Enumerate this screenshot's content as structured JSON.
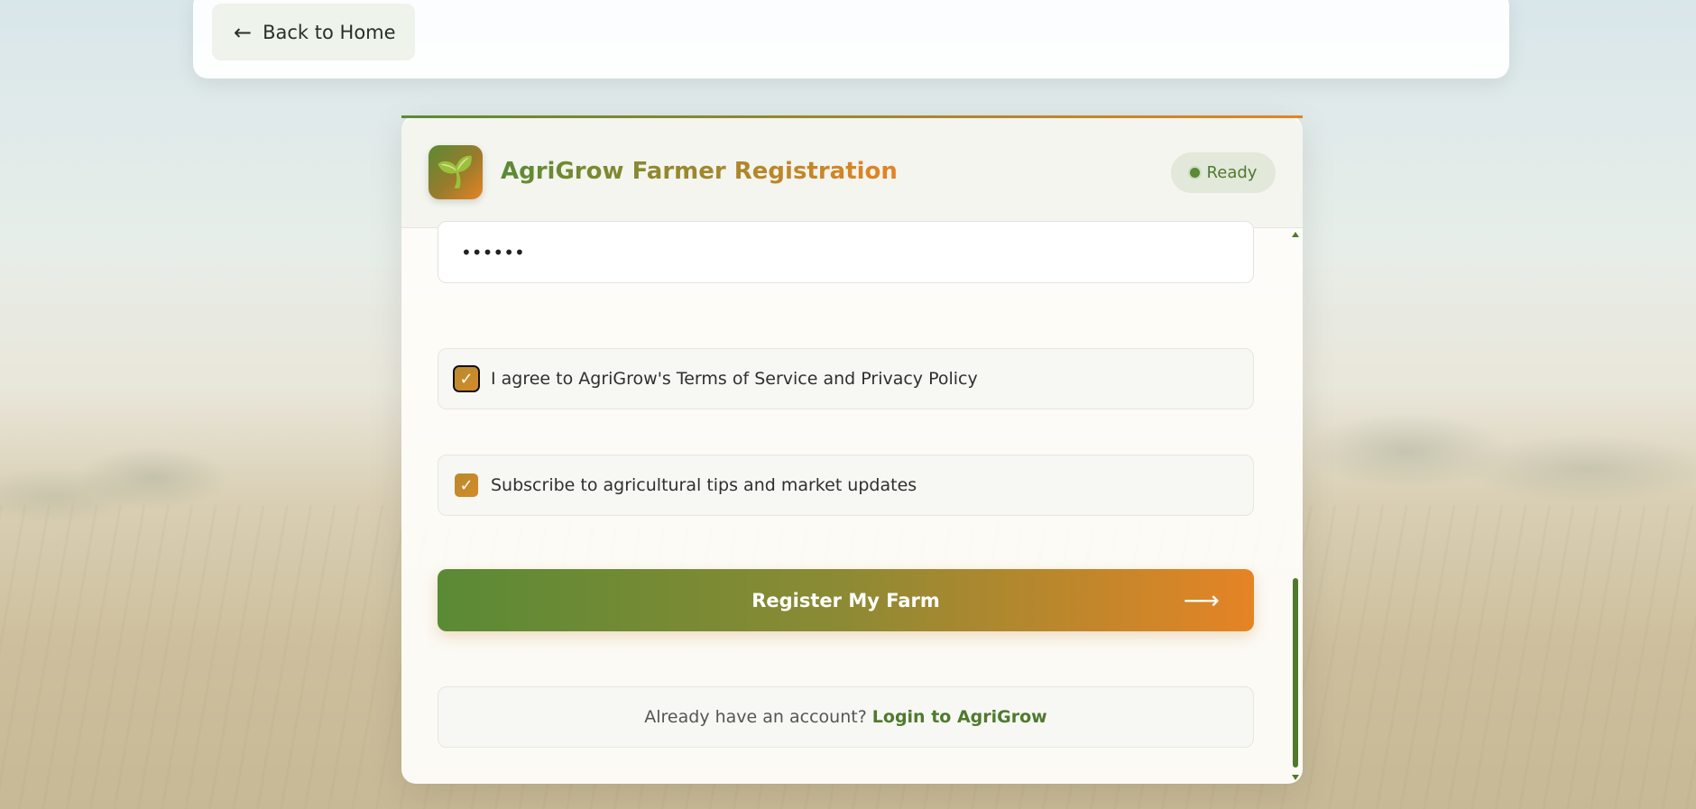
{
  "nav": {
    "back_arrow": "←",
    "back_label": "Back to Home"
  },
  "header": {
    "logo_icon": "🌱",
    "title": "AgriGrow Farmer Registration",
    "status": "Ready"
  },
  "form": {
    "password_value": "••••••",
    "terms_label": "I agree to AgriGrow's Terms of Service and Privacy Policy",
    "terms_checked": true,
    "subscribe_label": "Subscribe to agricultural tips and market updates",
    "subscribe_checked": true,
    "check_mark": "✓",
    "submit_label": "Register My Farm",
    "submit_arrow": "⟶"
  },
  "footer": {
    "prompt": "Already have an account?",
    "login_link": "Login to AgriGrow"
  },
  "colors": {
    "brand_green": "#5a8a35",
    "brand_orange": "#e58425"
  }
}
